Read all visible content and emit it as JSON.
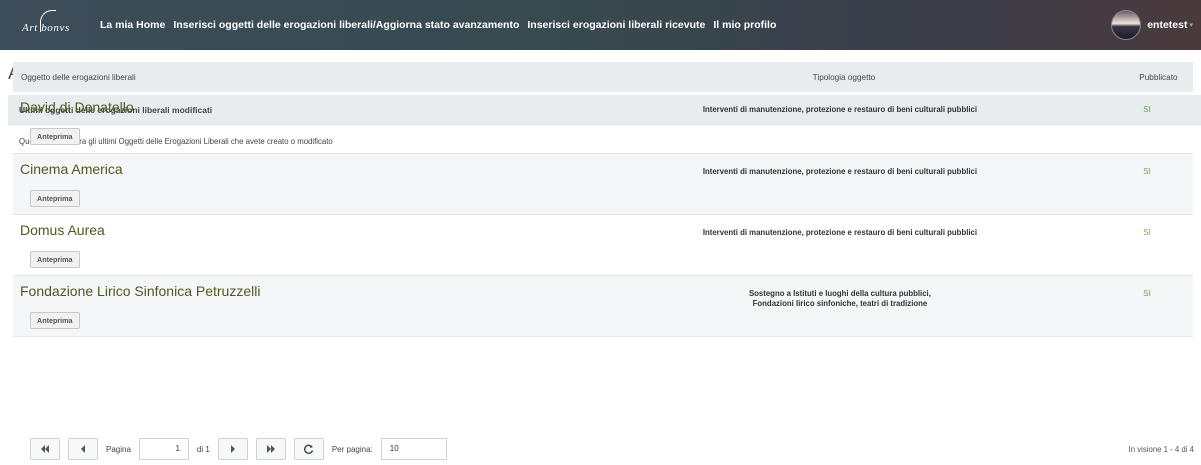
{
  "topbar": {
    "logo_text": "Art bonvs",
    "nav": [
      {
        "label": "La mia Home"
      },
      {
        "label": "Inserisci oggetti delle erogazioni liberali/Aggiorna stato avanzamento"
      },
      {
        "label": "Inserisci erogazioni liberali ricevute"
      },
      {
        "label": "Il mio profilo"
      }
    ],
    "user_name": "entetest"
  },
  "page_title": "Artbonus - La mia Home",
  "panel": {
    "heading": "Ultimi oggetti delle erogazioni liberali modificati",
    "description": "Questa lista mostra gli ultimi Oggetti delle Erogazioni Liberali che avete creato o modificato",
    "columns": [
      "Oggetto delle erogazioni liberali",
      "Tipologia oggetto",
      "Pubblicato"
    ],
    "preview_label": "Anteprima",
    "rows": [
      {
        "title": "David di Donatello",
        "tipo_1": "Interventi di manutenzione, protezione e restauro di beni culturali pubblici",
        "tipo_2": "",
        "pubblicato": "SI"
      },
      {
        "title": "Cinema America",
        "tipo_1": "Interventi di manutenzione, protezione e restauro di beni culturali pubblici",
        "tipo_2": "",
        "pubblicato": "SI"
      },
      {
        "title": "Domus Aurea",
        "tipo_1": "Interventi di manutenzione, protezione e restauro di beni culturali pubblici",
        "tipo_2": "",
        "pubblicato": "SI"
      },
      {
        "title": "Fondazione Lirico Sinfonica Petruzzelli",
        "tipo_1": "Sostegno a Istituti e luoghi della cultura pubblici,",
        "tipo_2": "Fondazioni lirico sinfoniche, teatri di tradizione",
        "pubblicato": "SI"
      }
    ]
  },
  "pager": {
    "page_label": "Pagina",
    "page_value": "1",
    "of_label": "di 1",
    "per_page_label": "Per pagina:",
    "per_page_value": "10",
    "info": "In visione 1 - 4 di 4"
  }
}
